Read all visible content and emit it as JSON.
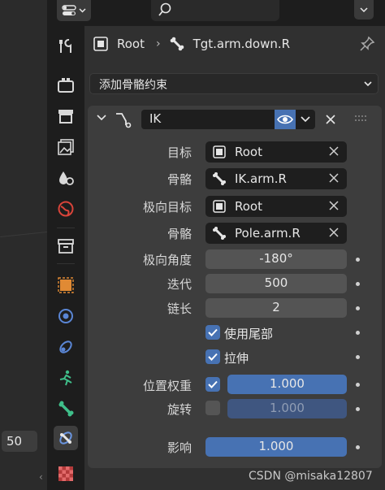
{
  "viewport": {
    "frame_value": "50"
  },
  "breadcrumb": {
    "object": "Root",
    "bone": "Tgt.arm.down.R"
  },
  "add_constraint": {
    "label": "添加骨骼约束"
  },
  "constraint": {
    "name": "IK",
    "target_label": "目标",
    "target_value": "Root",
    "bone_label": "骨骼",
    "bone_value": "IK.arm.R",
    "pole_target_label": "极向目标",
    "pole_target_value": "Root",
    "pole_bone_label": "骨骼",
    "pole_bone_value": "Pole.arm.R",
    "pole_angle_label": "极向角度",
    "pole_angle_value": "-180°",
    "iterations_label": "迭代",
    "iterations_value": "500",
    "chain_length_label": "链长",
    "chain_length_value": "2",
    "use_tail_label": "使用尾部",
    "use_tail_checked": true,
    "stretch_label": "拉伸",
    "stretch_checked": true,
    "weight_position_label": "位置权重",
    "weight_position_value": "1.000",
    "weight_position_checked": true,
    "rotation_label": "旋转",
    "rotation_value": "1.000",
    "rotation_checked": false,
    "influence_label": "影响",
    "influence_value": "1.000"
  },
  "watermark": "CSDN @misaka12807",
  "colors": {
    "accent": "#4772b3",
    "panel": "#3d3d3d",
    "field": "#1e1e1e"
  }
}
